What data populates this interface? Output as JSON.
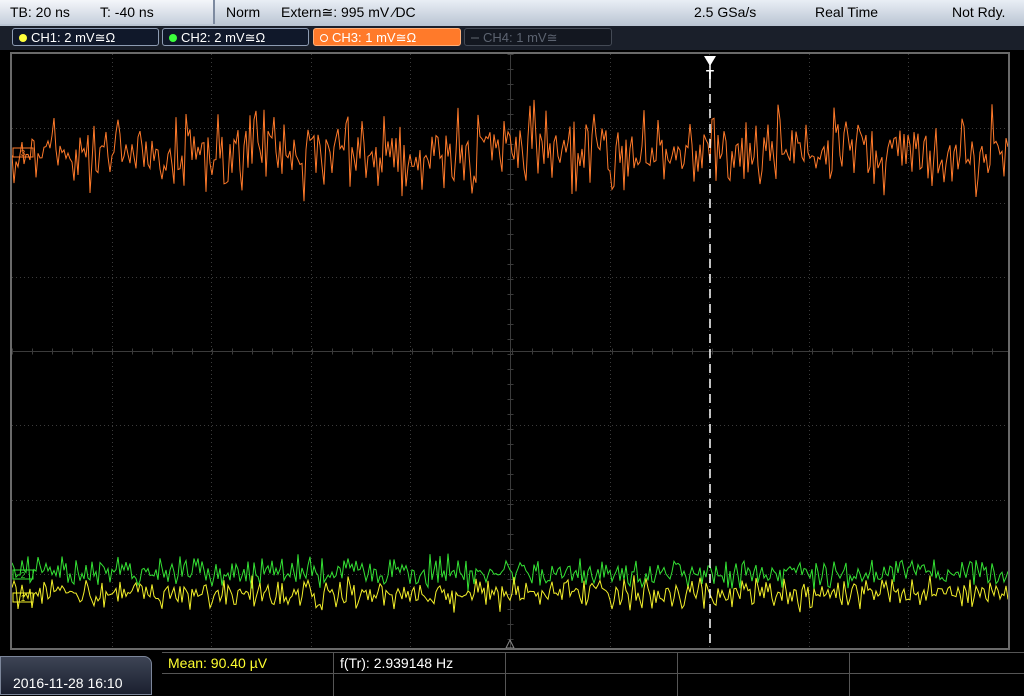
{
  "header": {
    "timebase": "TB: 20 ns",
    "trigger_time": "T: -40 ns",
    "mode": "Norm",
    "trigger_source": "Extern≅: 995 mV ⁄DC",
    "sample_rate": "2.5 GSa/s",
    "acquisition": "Real Time",
    "status": "Not Rdy."
  },
  "channels": [
    {
      "label": "CH1: 2 mV≅Ω",
      "color": "#ffff3c",
      "state": "on"
    },
    {
      "label": "CH2: 2 mV≅Ω",
      "color": "#3cff3c",
      "state": "on"
    },
    {
      "label": "CH3: 1 mV≅Ω",
      "color": "#ff7a2a",
      "state": "selected"
    },
    {
      "label": "CH4: 1 mV≅",
      "color": "#5c6370",
      "state": "off"
    }
  ],
  "markers": {
    "trigger_label": "T",
    "ch3_ref": "3",
    "ch2_ref": "2",
    "ch1_ref": "1"
  },
  "measurements": {
    "mean": "Mean: 90.40 µV",
    "freq": "f(Tr): 2.939148 Hz"
  },
  "datetime": "2016-11-28 16:10",
  "colors": {
    "ch1": "#f3ef2a",
    "ch2": "#34e234",
    "ch3": "#ff7a2a",
    "grid": "#3b3b3b",
    "measure_text": "#ffff30"
  }
}
